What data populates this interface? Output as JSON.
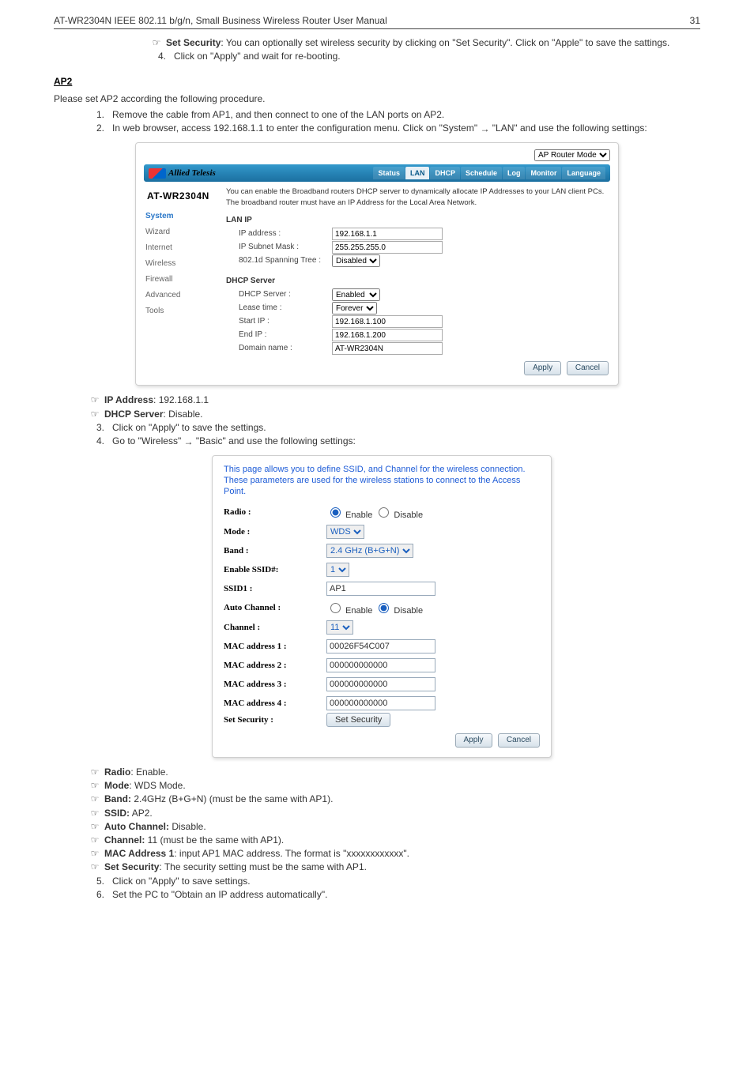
{
  "header": {
    "left": "AT-WR2304N IEEE 802.11 b/g/n, Small Business Wireless Router User Manual",
    "right": "31"
  },
  "intro": {
    "bullet_set_security_label": "Set Security",
    "bullet_set_security_text": ": You can optionally set wireless security by clicking on \"Set Security\". Click on \"Apple\" to save the sattings.",
    "step4": "Click on \"Apply\" and wait for re-booting."
  },
  "ap2": {
    "title": "AP2",
    "lead": "Please set AP2 according the following procedure.",
    "s1": "Remove the cable from AP1, and then connect to one of the LAN ports on AP2.",
    "s2a": "In web browser, access 192.168.1.1 to enter the configuration menu. Click on \"System\" ",
    "s2b": " \"LAN\" and use the following settings:"
  },
  "shot1": {
    "mode_selector": "AP Router Mode",
    "mode_options": [
      "AP Router Mode"
    ],
    "logo_text": "Allied Telesis",
    "tabs": [
      "Status",
      "LAN",
      "DHCP",
      "Schedule",
      "Log",
      "Monitor",
      "Language"
    ],
    "active_tab_idx": 1,
    "model": "AT-WR2304N",
    "nav": [
      "System",
      "Wizard",
      "Internet",
      "Wireless",
      "Firewall",
      "Advanced",
      "Tools"
    ],
    "nav_active_idx": 0,
    "note": "You can enable the Broadband routers DHCP server to dynamically allocate IP Addresses to your LAN client PCs. The broadband router must have an IP Address for the Local Area Network.",
    "sec_lanip": "LAN IP",
    "fields_lan": [
      {
        "l": "IP address :",
        "v": "192.168.1.1",
        "type": "text"
      },
      {
        "l": "IP Subnet Mask :",
        "v": "255.255.255.0",
        "type": "text"
      },
      {
        "l": "802.1d Spanning Tree :",
        "v": "Disabled",
        "type": "select",
        "opts": [
          "Disabled",
          "Enabled"
        ]
      }
    ],
    "sec_dhcp": "DHCP Server",
    "fields_dhcp": [
      {
        "l": "DHCP Server :",
        "v": "Enabled",
        "type": "select",
        "opts": [
          "Enabled",
          "Disabled"
        ]
      },
      {
        "l": "Lease time :",
        "v": "Forever",
        "type": "select",
        "opts": [
          "Forever"
        ]
      },
      {
        "l": "Start IP :",
        "v": "192.168.1.100",
        "type": "text"
      },
      {
        "l": "End IP :",
        "v": "192.168.1.200",
        "type": "text"
      },
      {
        "l": "Domain name :",
        "v": "AT-WR2304N",
        "type": "text"
      }
    ],
    "apply": "Apply",
    "cancel": "Cancel"
  },
  "after_shot1": {
    "ip_label": "IP Address",
    "ip_text": ": 192.168.1.1",
    "dhcp_label": "DHCP Server",
    "dhcp_text": ": Disable.",
    "s3": "Click on \"Apply\" to save the settings.",
    "s4a": "Go to \"Wireless\" ",
    "s4b": " \"Basic\" and use the following settings:"
  },
  "shot2": {
    "desc": "This page allows you to define SSID, and Channel for the wireless connection. These parameters are used for the wireless stations to connect to the Access Point.",
    "rows": [
      {
        "lab": "Radio :",
        "type": "radios",
        "opts": [
          "Enable",
          "Disable"
        ],
        "sel": 0
      },
      {
        "lab": "Mode :",
        "type": "select",
        "opts": [
          "WDS"
        ],
        "sel": 0
      },
      {
        "lab": "Band :",
        "type": "select",
        "opts": [
          "2.4 GHz (B+G+N)"
        ],
        "sel": 0
      },
      {
        "lab": "Enable SSID#:",
        "type": "select",
        "opts": [
          "1"
        ],
        "sel": 0
      },
      {
        "lab": "SSID1 :",
        "type": "text",
        "val": "AP1"
      },
      {
        "lab": "Auto Channel :",
        "type": "radios",
        "opts": [
          "Enable",
          "Disable"
        ],
        "sel": 1
      },
      {
        "lab": "Channel :",
        "type": "select",
        "opts": [
          "11"
        ],
        "sel": 0
      },
      {
        "lab": "MAC address 1 :",
        "type": "text",
        "val": "00026F54C007"
      },
      {
        "lab": "MAC address 2 :",
        "type": "text",
        "val": "000000000000"
      },
      {
        "lab": "MAC address 3 :",
        "type": "text",
        "val": "000000000000"
      },
      {
        "lab": "MAC address 4 :",
        "type": "text",
        "val": "000000000000"
      },
      {
        "lab": "Set Security :",
        "type": "button",
        "val": "Set Security"
      }
    ],
    "apply": "Apply",
    "cancel": "Cancel"
  },
  "after_shot2": {
    "bullets": [
      {
        "b": "Radio",
        "t": ": Enable."
      },
      {
        "b": "Mode",
        "t": ": WDS Mode."
      },
      {
        "b": "Band:",
        "t": " 2.4GHz (B+G+N) (must be the same with AP1)."
      },
      {
        "b": "SSID:",
        "t": " AP2."
      },
      {
        "b": "Auto Channel:",
        "t": " Disable."
      },
      {
        "b": "Channel:",
        "t": " 11 (must be the same with AP1)."
      },
      {
        "b": "MAC Address 1",
        "t": ": input AP1 MAC address. The format is \"xxxxxxxxxxxx\"."
      },
      {
        "b": "Set Security",
        "t": ": The security setting must be the same with AP1."
      }
    ],
    "s5": "Click on \"Apply\" to save settings.",
    "s6": "Set the PC to \"Obtain an IP address automatically\"."
  },
  "glyph": {
    "hand": "☞",
    "arrow": "→"
  }
}
